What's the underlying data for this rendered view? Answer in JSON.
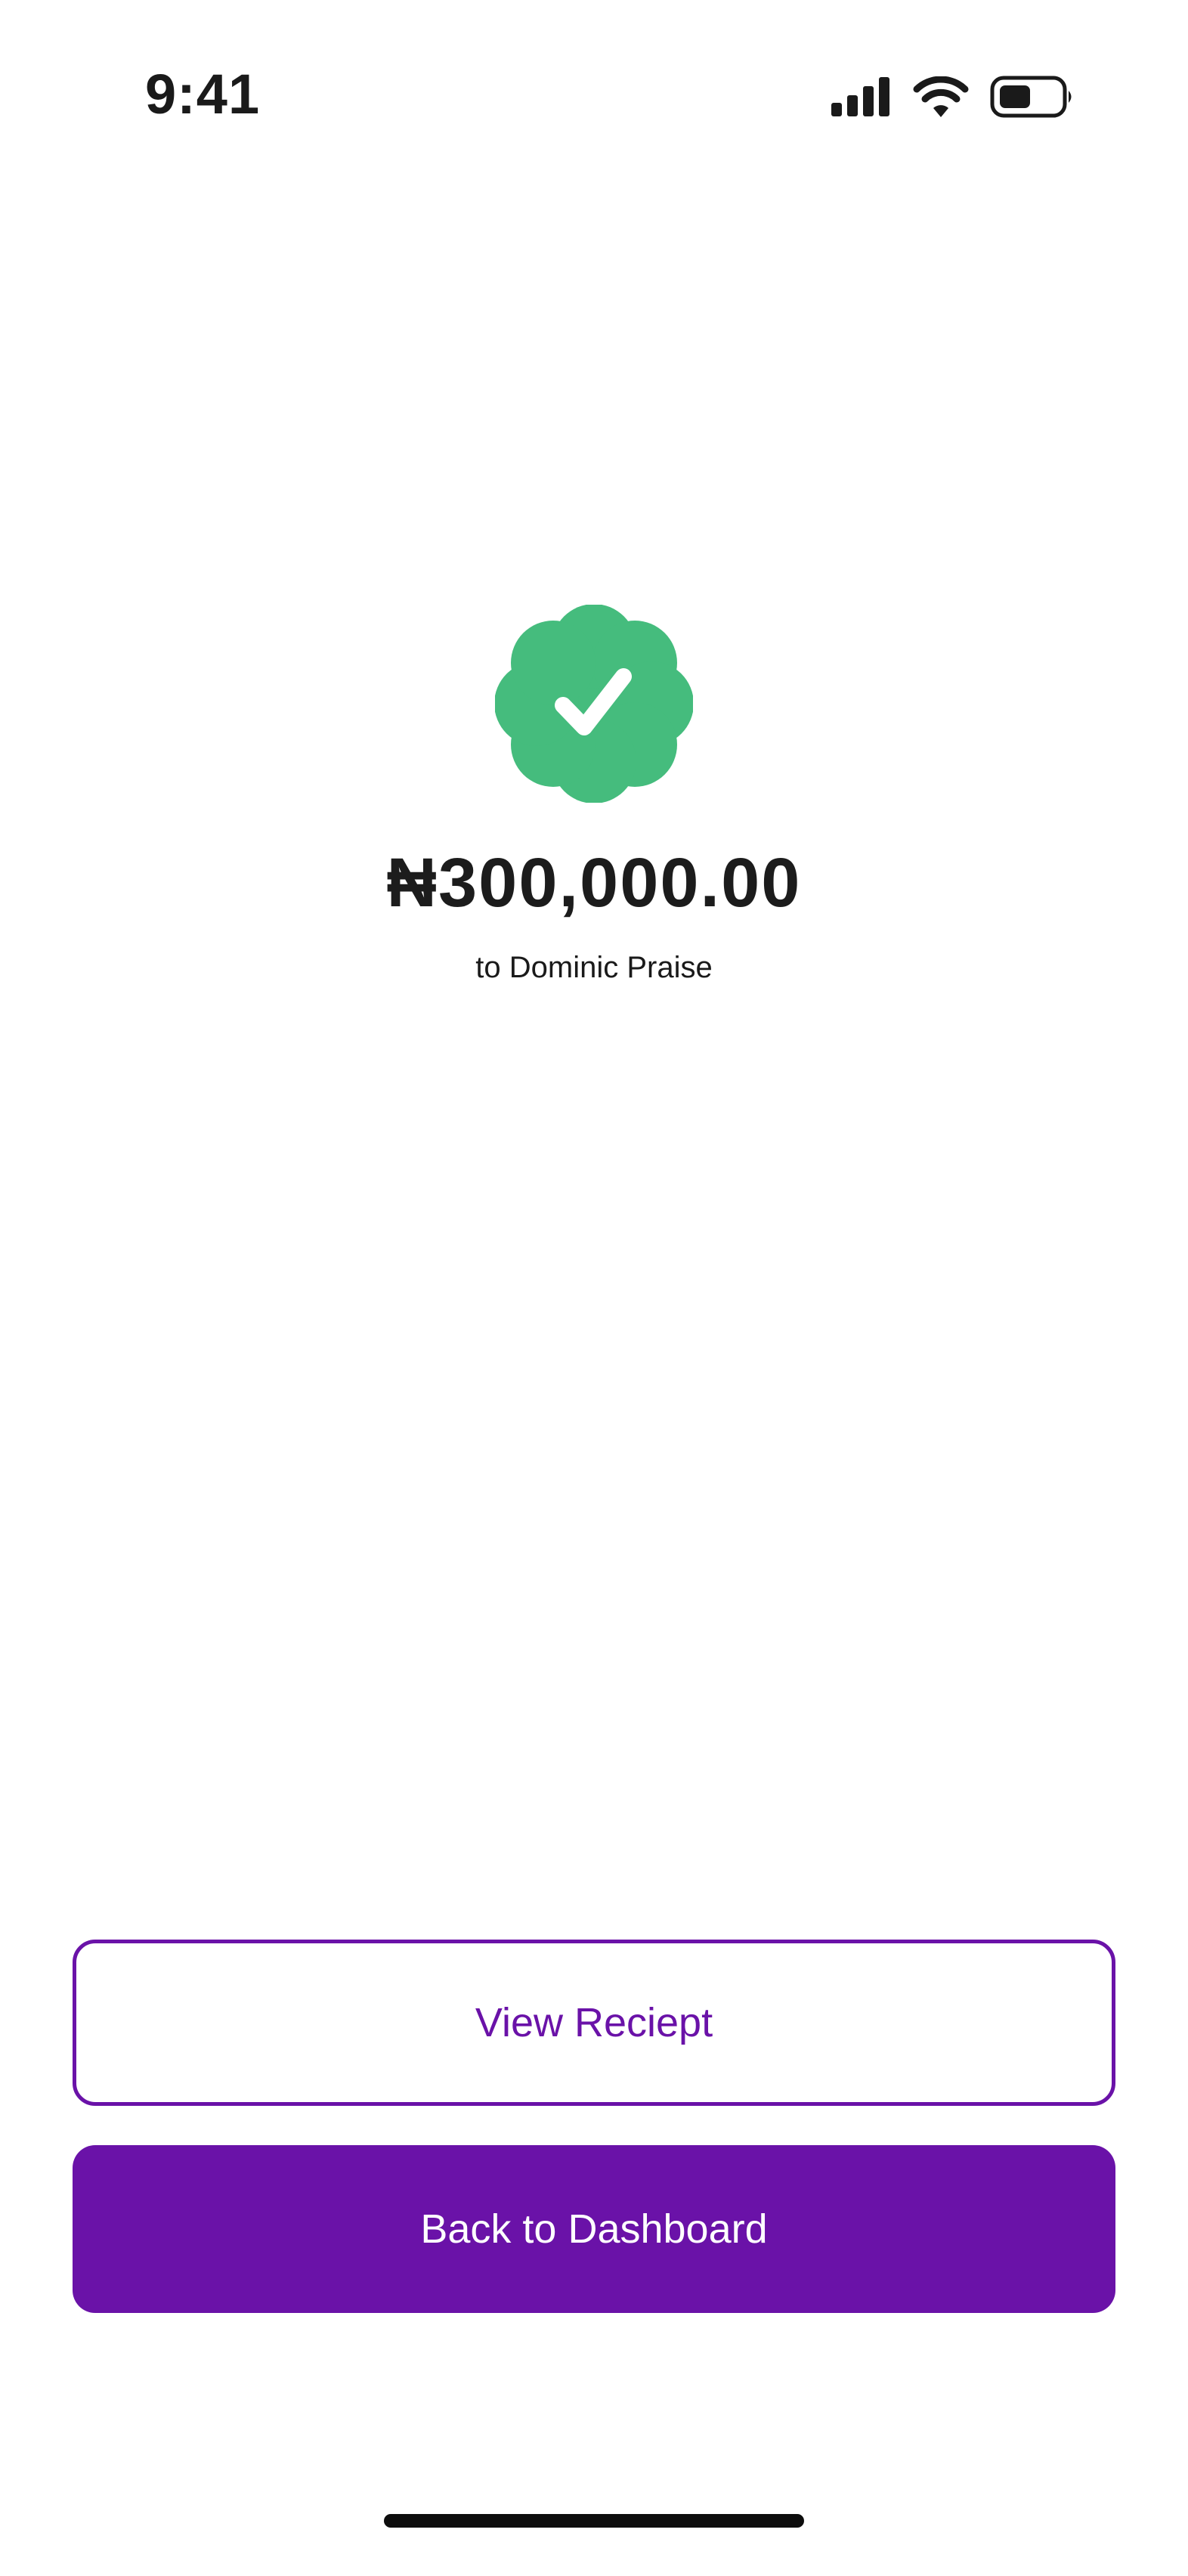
{
  "status_bar": {
    "time": "9:41",
    "icons": [
      "cellular-signal-icon",
      "wifi-icon",
      "battery-icon"
    ]
  },
  "success": {
    "icon": "verified-check-badge-icon",
    "icon_color": "#45BC7D",
    "amount": "₦300,000.00",
    "recipient": "to Dominic Praise"
  },
  "actions": {
    "view_receipt_label": "View Reciept",
    "back_to_dashboard_label": "Back to Dashboard",
    "accent_color": "#6A12A8"
  }
}
